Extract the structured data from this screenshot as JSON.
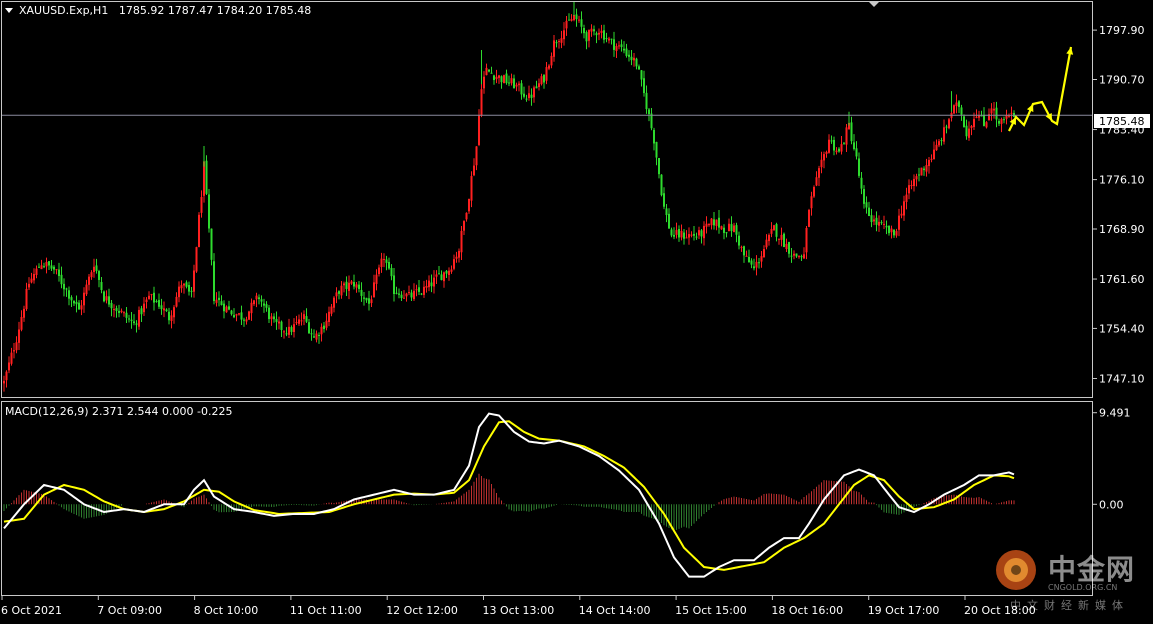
{
  "chart_data": {
    "type": "candlestick",
    "symbol_label": "XAUUSD.Exp,H1",
    "ohlc_label": "1785.92 1787.47 1784.20 1785.48",
    "current_price": 1785.48,
    "current_price_label": "1785.48",
    "price_axis": {
      "ylim": [
        1744.4,
        1802.0
      ],
      "ticks": [
        "1797.90",
        "1790.70",
        "1783.40",
        "1776.10",
        "1768.90",
        "1761.60",
        "1754.40",
        "1747.10"
      ]
    },
    "time_axis": {
      "labels": [
        "6 Oct 2021",
        "7 Oct 09:00",
        "8 Oct 10:00",
        "11 Oct 11:00",
        "12 Oct 12:00",
        "13 Oct 13:00",
        "14 Oct 14:00",
        "15 Oct 15:00",
        "18 Oct 16:00",
        "19 Oct 17:00",
        "20 Oct 18:00"
      ]
    },
    "close_keypoints": [
      [
        0,
        1746.5
      ],
      [
        5,
        1753
      ],
      [
        10,
        1761
      ],
      [
        15,
        1764
      ],
      [
        20,
        1763
      ],
      [
        25,
        1760
      ],
      [
        30,
        1757
      ],
      [
        36,
        1764
      ],
      [
        40,
        1759
      ],
      [
        46,
        1757
      ],
      [
        52,
        1755
      ],
      [
        58,
        1759
      ],
      [
        62,
        1758
      ],
      [
        66,
        1756
      ],
      [
        71,
        1761
      ],
      [
        75,
        1759
      ],
      [
        80,
        1778
      ],
      [
        84,
        1759
      ],
      [
        90,
        1757
      ],
      [
        96,
        1756
      ],
      [
        102,
        1759
      ],
      [
        108,
        1755
      ],
      [
        114,
        1754
      ],
      [
        120,
        1756
      ],
      [
        124,
        1753
      ],
      [
        128,
        1755
      ],
      [
        134,
        1760
      ],
      [
        140,
        1761
      ],
      [
        146,
        1758
      ],
      [
        152,
        1765
      ],
      [
        156,
        1760
      ],
      [
        162,
        1759
      ],
      [
        168,
        1760
      ],
      [
        174,
        1762
      ],
      [
        178,
        1763
      ],
      [
        182,
        1766
      ],
      [
        186,
        1774
      ],
      [
        189,
        1781
      ],
      [
        191,
        1790
      ],
      [
        193,
        1792
      ],
      [
        198,
        1791
      ],
      [
        204,
        1790
      ],
      [
        210,
        1788
      ],
      [
        216,
        1791
      ],
      [
        220,
        1796
      ],
      [
        224,
        1798
      ],
      [
        228,
        1800
      ],
      [
        233,
        1797
      ],
      [
        238,
        1798
      ],
      [
        243,
        1796
      ],
      [
        248,
        1795
      ],
      [
        253,
        1793
      ],
      [
        257,
        1787
      ],
      [
        260,
        1782
      ],
      [
        264,
        1772
      ],
      [
        267,
        1768
      ],
      [
        272,
        1768
      ],
      [
        278,
        1768
      ],
      [
        284,
        1770
      ],
      [
        288,
        1769
      ],
      [
        292,
        1769
      ],
      [
        296,
        1765
      ],
      [
        300,
        1763
      ],
      [
        304,
        1766
      ],
      [
        308,
        1769
      ],
      [
        312,
        1767
      ],
      [
        316,
        1765
      ],
      [
        320,
        1765
      ],
      [
        322,
        1772
      ],
      [
        326,
        1777
      ],
      [
        330,
        1782
      ],
      [
        334,
        1780
      ],
      [
        338,
        1784
      ],
      [
        341,
        1779
      ],
      [
        344,
        1772
      ],
      [
        348,
        1770
      ],
      [
        352,
        1769
      ],
      [
        356,
        1768
      ],
      [
        360,
        1773
      ],
      [
        364,
        1776
      ],
      [
        368,
        1778
      ],
      [
        372,
        1780
      ],
      [
        376,
        1783
      ],
      [
        379,
        1786
      ],
      [
        382,
        1787
      ],
      [
        385,
        1783
      ],
      [
        389,
        1786
      ],
      [
        392,
        1784
      ],
      [
        395,
        1787
      ],
      [
        398,
        1784
      ],
      [
        401,
        1785
      ],
      [
        404,
        1785.48
      ]
    ],
    "macd": {
      "label": "MACD(12,26,9) 2.371 2.544 0.000 -0.225",
      "ylim": [
        -9.4,
        10.6
      ],
      "ticks": [
        "9.491",
        "0.00"
      ],
      "hidden_tick": "-9.5",
      "main_keypoints": [
        [
          0,
          -2.5
        ],
        [
          8,
          0
        ],
        [
          16,
          2
        ],
        [
          24,
          1.5
        ],
        [
          32,
          0
        ],
        [
          40,
          -0.8
        ],
        [
          48,
          -0.5
        ],
        [
          56,
          -0.8
        ],
        [
          64,
          0
        ],
        [
          72,
          0
        ],
        [
          76,
          1.5
        ],
        [
          80,
          2.5
        ],
        [
          84,
          0.8
        ],
        [
          92,
          -0.5
        ],
        [
          100,
          -0.8
        ],
        [
          108,
          -1.2
        ],
        [
          116,
          -1.0
        ],
        [
          124,
          -1.0
        ],
        [
          132,
          -0.5
        ],
        [
          140,
          0.5
        ],
        [
          148,
          1.0
        ],
        [
          156,
          1.5
        ],
        [
          164,
          1.0
        ],
        [
          172,
          1.0
        ],
        [
          180,
          1.5
        ],
        [
          186,
          4.0
        ],
        [
          190,
          8.0
        ],
        [
          194,
          9.4
        ],
        [
          198,
          9.2
        ],
        [
          204,
          7.5
        ],
        [
          210,
          6.5
        ],
        [
          216,
          6.3
        ],
        [
          222,
          6.6
        ],
        [
          230,
          6.0
        ],
        [
          238,
          5.0
        ],
        [
          246,
          3.5
        ],
        [
          254,
          1.5
        ],
        [
          262,
          -2.0
        ],
        [
          268,
          -5.5
        ],
        [
          274,
          -7.5
        ],
        [
          280,
          -7.5
        ],
        [
          286,
          -6.5
        ],
        [
          292,
          -5.8
        ],
        [
          300,
          -5.8
        ],
        [
          306,
          -4.5
        ],
        [
          312,
          -3.5
        ],
        [
          318,
          -3.5
        ],
        [
          322,
          -2.0
        ],
        [
          328,
          0.5
        ],
        [
          336,
          3.0
        ],
        [
          342,
          3.6
        ],
        [
          348,
          3.0
        ],
        [
          354,
          1.0
        ],
        [
          358,
          -0.3
        ],
        [
          364,
          -0.8
        ],
        [
          370,
          0
        ],
        [
          376,
          1.0
        ],
        [
          384,
          2.0
        ],
        [
          390,
          3.0
        ],
        [
          396,
          3.0
        ],
        [
          402,
          3.3
        ],
        [
          404,
          3.1
        ]
      ],
      "signal_keypoints": [
        [
          0,
          -1.8
        ],
        [
          8,
          -1.5
        ],
        [
          16,
          1.0
        ],
        [
          24,
          2.0
        ],
        [
          32,
          1.5
        ],
        [
          40,
          0.3
        ],
        [
          48,
          -0.5
        ],
        [
          56,
          -0.8
        ],
        [
          64,
          -0.5
        ],
        [
          72,
          0.3
        ],
        [
          80,
          1.5
        ],
        [
          86,
          1.3
        ],
        [
          92,
          0.3
        ],
        [
          100,
          -0.6
        ],
        [
          110,
          -1.0
        ],
        [
          120,
          -0.9
        ],
        [
          130,
          -0.8
        ],
        [
          140,
          0
        ],
        [
          148,
          0.5
        ],
        [
          156,
          1.0
        ],
        [
          164,
          1.1
        ],
        [
          172,
          1.0
        ],
        [
          180,
          1.2
        ],
        [
          186,
          2.5
        ],
        [
          192,
          6.0
        ],
        [
          198,
          8.5
        ],
        [
          202,
          8.6
        ],
        [
          208,
          7.5
        ],
        [
          214,
          6.8
        ],
        [
          222,
          6.6
        ],
        [
          232,
          6.0
        ],
        [
          240,
          5.0
        ],
        [
          248,
          3.8
        ],
        [
          256,
          1.8
        ],
        [
          264,
          -1.0
        ],
        [
          272,
          -4.5
        ],
        [
          280,
          -6.5
        ],
        [
          288,
          -6.8
        ],
        [
          296,
          -6.4
        ],
        [
          304,
          -6.0
        ],
        [
          312,
          -4.5
        ],
        [
          320,
          -3.5
        ],
        [
          328,
          -2.0
        ],
        [
          334,
          0
        ],
        [
          340,
          2.0
        ],
        [
          346,
          3.0
        ],
        [
          352,
          2.5
        ],
        [
          358,
          0.8
        ],
        [
          364,
          -0.5
        ],
        [
          372,
          -0.3
        ],
        [
          380,
          0.5
        ],
        [
          388,
          2.0
        ],
        [
          396,
          3.0
        ],
        [
          402,
          2.9
        ],
        [
          404,
          2.7
        ]
      ]
    },
    "projection_arrow": {
      "color": "#ffff00",
      "points": [
        [
          1009,
          131
        ],
        [
          1016,
          117
        ],
        [
          1024,
          125
        ],
        [
          1033,
          104
        ],
        [
          1042,
          102
        ],
        [
          1052,
          121
        ],
        [
          1057,
          124
        ],
        [
          1071,
          47
        ]
      ]
    },
    "colors": {
      "bull": "#ff2020",
      "bear": "#2edb2e",
      "macd_main": "#ffffff",
      "macd_signal": "#ffff00",
      "hist_pos": "#c03030",
      "hist_neg": "#2e7d2e",
      "axis_text": "#ffffff",
      "border": "#c8c8c8",
      "price_line": "#8a8a9e"
    }
  },
  "watermark": {
    "brand": "中金网",
    "site": "CNGOLD.ORG.CN",
    "tagline": "中文财经新媒体"
  }
}
